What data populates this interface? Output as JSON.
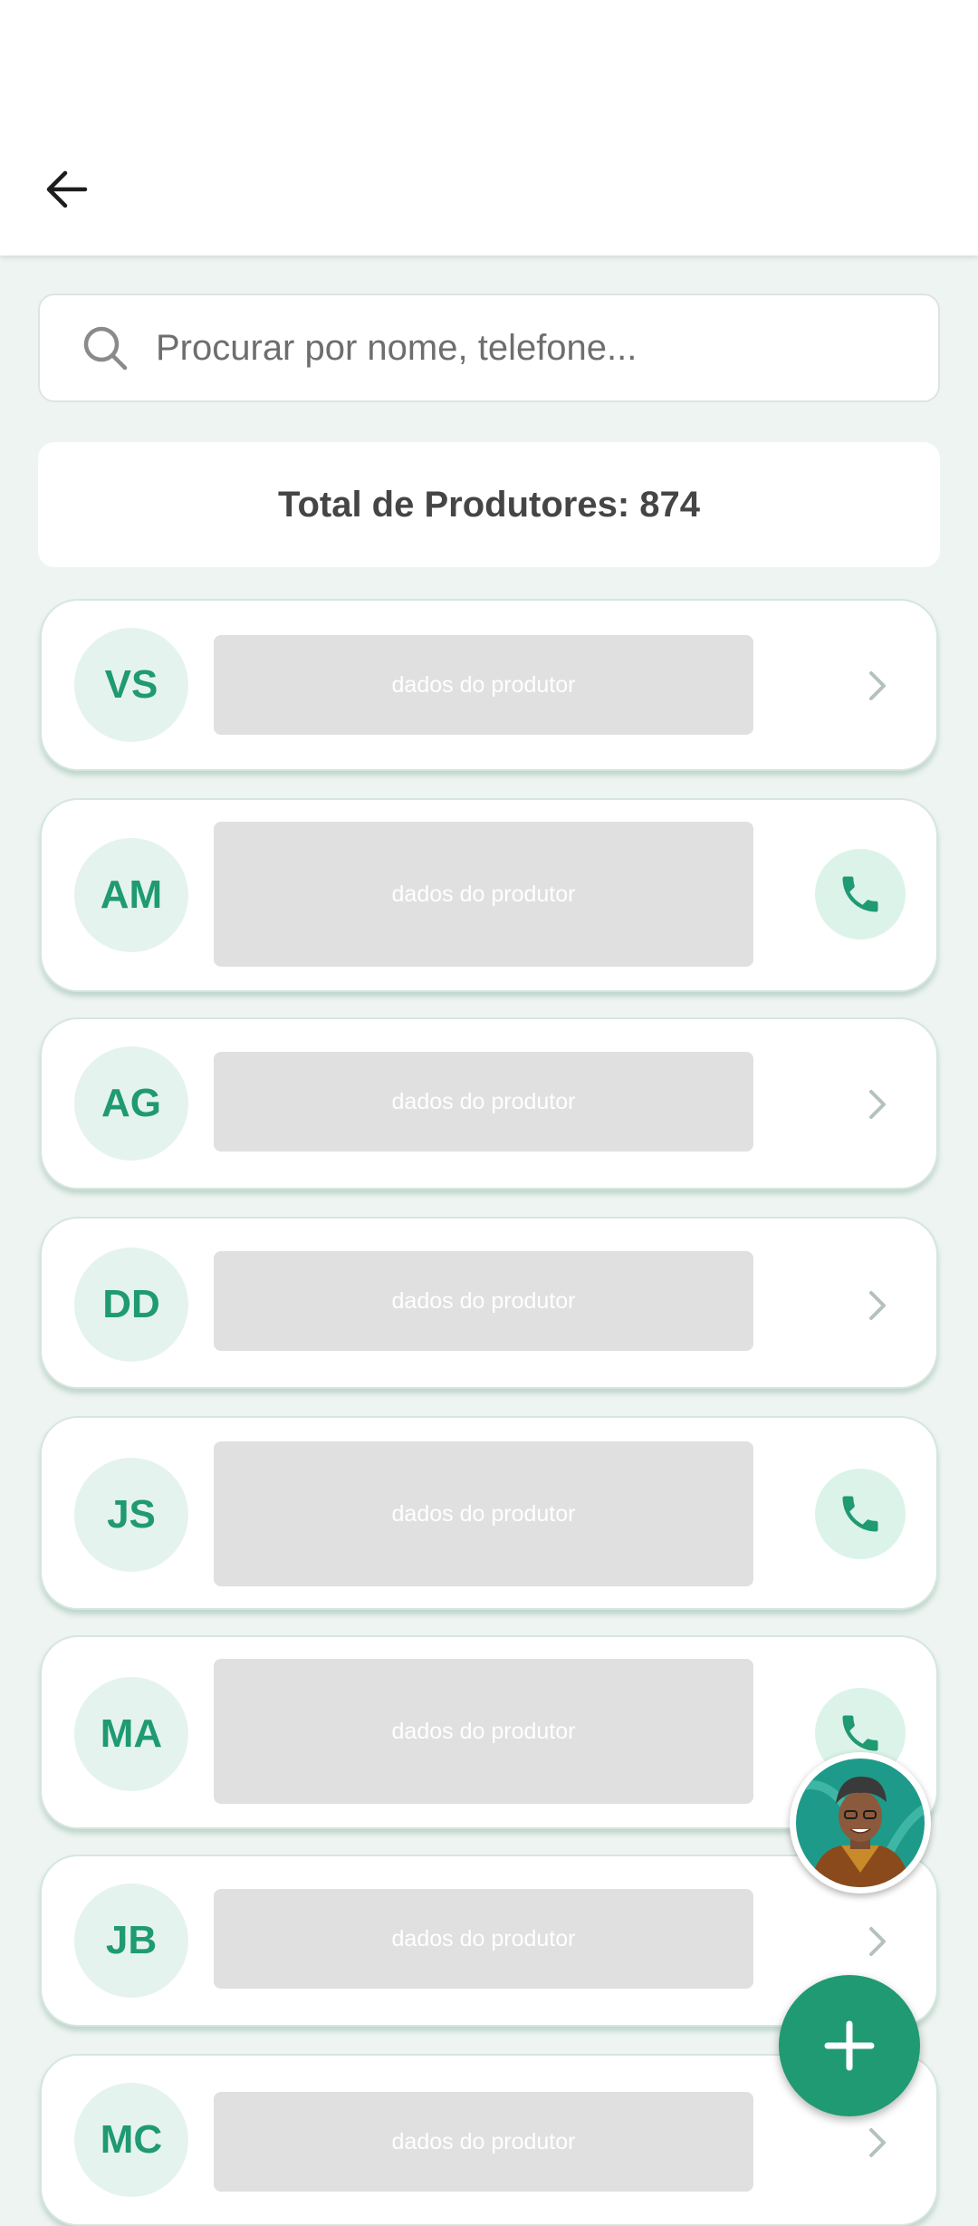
{
  "search": {
    "placeholder": "Procurar por nome, telefone..."
  },
  "summary": {
    "total_label": "Total de Produtores: 874"
  },
  "producers": [
    {
      "initials": "VS",
      "data_label": "dados do produtor",
      "action": "chevron-right-icon"
    },
    {
      "initials": "AM",
      "data_label": "dados do produtor",
      "action": "phone-icon"
    },
    {
      "initials": "AG",
      "data_label": "dados do produtor",
      "action": "chevron-right-icon"
    },
    {
      "initials": "DD",
      "data_label": "dados do produtor",
      "action": "chevron-right-icon"
    },
    {
      "initials": "JS",
      "data_label": "dados do produtor",
      "action": "phone-icon"
    },
    {
      "initials": "MA",
      "data_label": "dados do produtor",
      "action": "phone-icon"
    },
    {
      "initials": "JB",
      "data_label": "dados do produtor",
      "action": "chevron-right-icon"
    },
    {
      "initials": "MC",
      "data_label": "dados do produtor",
      "action": "chevron-right-icon"
    }
  ],
  "colors": {
    "accent": "#1f9a72",
    "avatar_bg": "#e5f3ee",
    "background": "#eef4f1"
  }
}
